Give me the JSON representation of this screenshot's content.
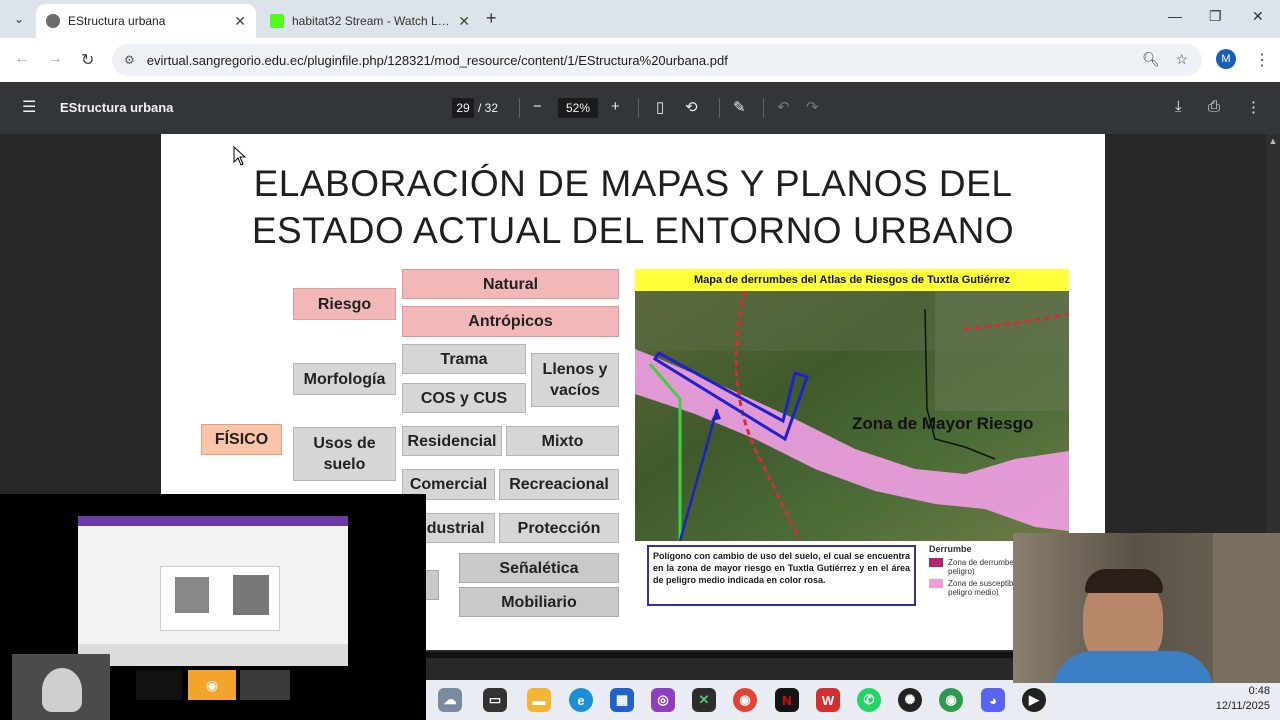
{
  "browser": {
    "tabs": [
      {
        "title": "EStructura urbana",
        "active": true
      },
      {
        "title": "habitat32 Stream - Watch Live on",
        "active": false
      }
    ],
    "url": "evirtual.sangregorio.edu.ec/pluginfile.php/128321/mod_resource/content/1/EStructura%20urbana.pdf",
    "profile_initial": "M"
  },
  "pdf_viewer": {
    "doc_title": "EStructura urbana",
    "current_page": "29",
    "total_pages": "/ 32",
    "zoom": "52%"
  },
  "slide": {
    "title_line1": "ELABORACIÓN DE MAPAS Y PLANOS DEL",
    "title_line2": "ESTADO ACTUAL DEL ENTORNO URBANO",
    "root": "FÍSICO",
    "categories": {
      "riesgo": "Riesgo",
      "morfologia": "Morfología",
      "usos_suelo": "Usos de suelo"
    },
    "items": {
      "natural": "Natural",
      "antropicos": "Antrópicos",
      "trama": "Trama",
      "cos_cus": "COS y CUS",
      "llenos_vacios": "Llenos y vacíos",
      "residencial": "Residencial",
      "mixto": "Mixto",
      "comercial": "Comercial",
      "recreacional": "Recreacional",
      "industrial": "Industrial",
      "proteccion": "Protección",
      "senaletica": "Señalética",
      "mobiliario": "Mobiliario"
    },
    "map": {
      "title": "Mapa de derrumbes del  Atlas de Riesgos de Tuxtla Gutiérrez",
      "zone_label": "Zona de Mayor Riesgo",
      "caption": "Polígono con cambio de uso del suelo, el cual se encuentra en la zona de mayor riesgo en Tuxtla Gutiérrez y en el área de peligro medio indicada en color rosa.",
      "legend_heading": "Derrumbe",
      "legend_items": [
        {
          "label": "Zona de derrumbe (zona de alto peligro)",
          "color": "#b0256e"
        },
        {
          "label": "Zona de susceptibilidad (zona de peligro medio)",
          "color": "#f09ad8"
        }
      ]
    }
  },
  "taskbar": {
    "time": "0:48",
    "date": "12/11/2025"
  }
}
